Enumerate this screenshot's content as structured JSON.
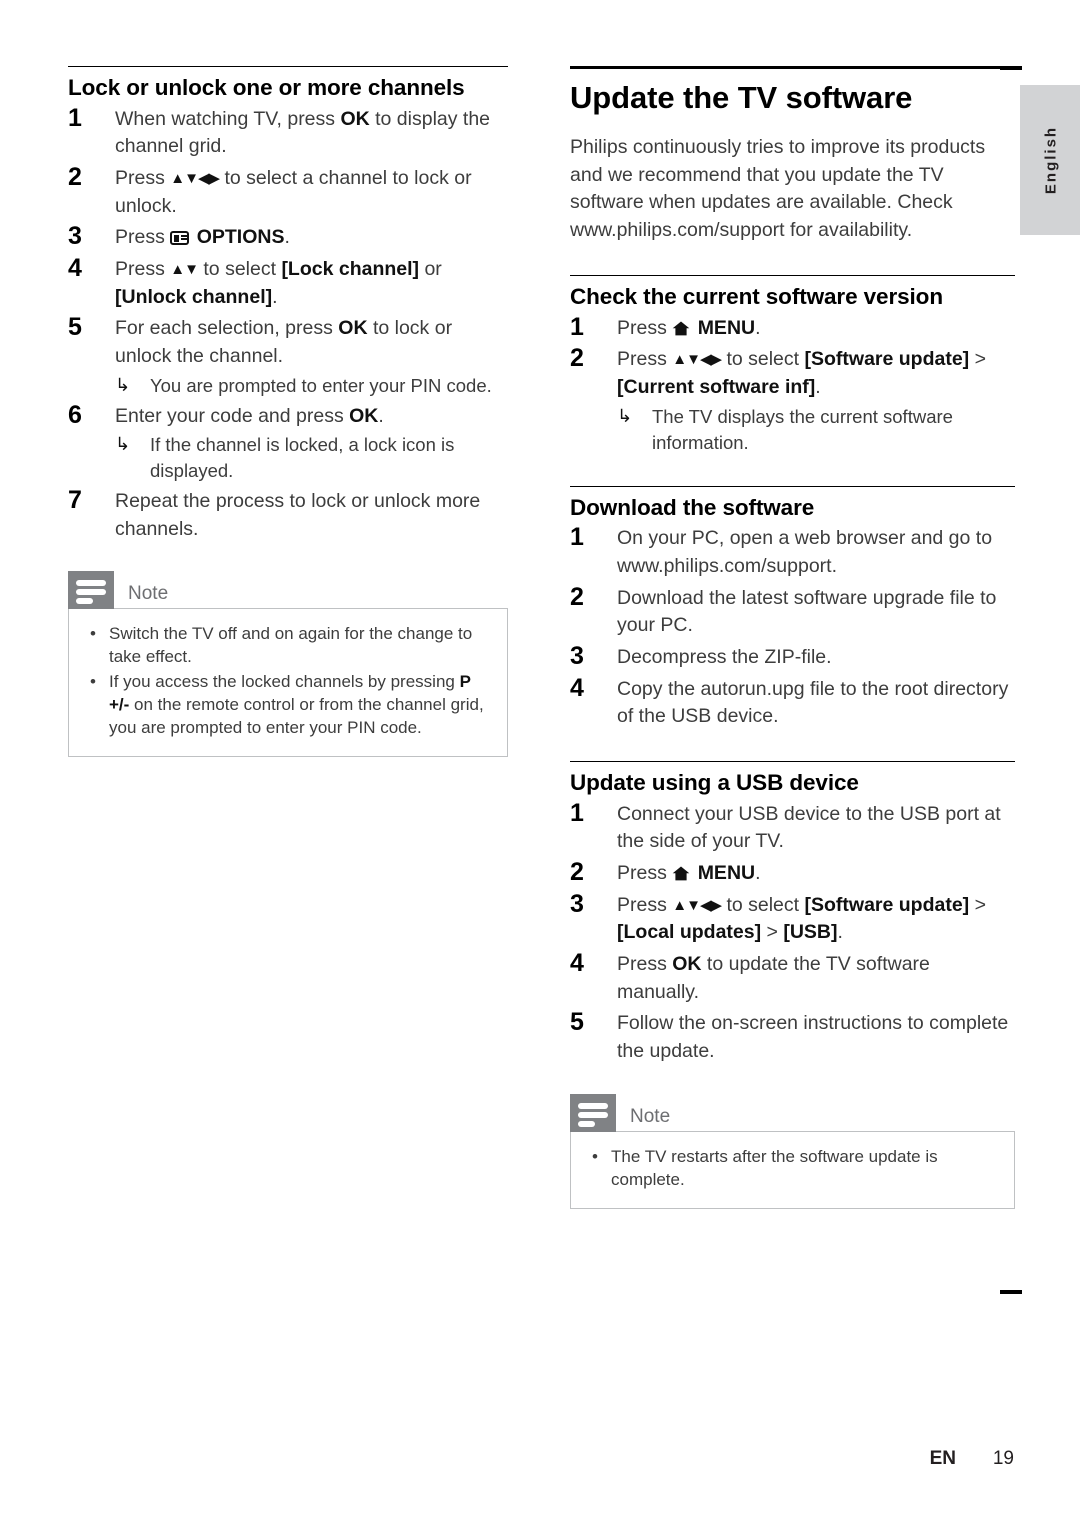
{
  "meta": {
    "language_tab": "English",
    "footer_code": "EN",
    "footer_page": "19"
  },
  "left_column": {
    "heading": "Lock or unlock one or more channels",
    "steps": [
      {
        "num": "1",
        "parts": [
          {
            "t": "When watching TV, press ",
            "b": false
          },
          {
            "t": "OK",
            "b": true
          },
          {
            "t": " to display the channel grid.",
            "b": false
          }
        ]
      },
      {
        "num": "2",
        "parts": [
          {
            "t": "Press ",
            "b": false
          },
          {
            "t": "▲▼◀▶",
            "b": false,
            "keys": true
          },
          {
            "t": " to select a channel to lock or unlock.",
            "b": false
          }
        ]
      },
      {
        "num": "3",
        "icon": "options-icon",
        "parts": [
          {
            "t": "Press ",
            "b": false
          },
          {
            "t": "ICON_OPTIONS",
            "b": false
          },
          {
            "t": "OPTIONS",
            "b": true
          },
          {
            "t": ".",
            "b": false
          }
        ]
      },
      {
        "num": "4",
        "parts": [
          {
            "t": "Press ",
            "b": false
          },
          {
            "t": "▲▼",
            "b": false,
            "keys": true
          },
          {
            "t": " to select ",
            "b": false
          },
          {
            "t": "[Lock channel]",
            "b": true
          },
          {
            "t": " or ",
            "b": false
          },
          {
            "t": "[Unlock channel]",
            "b": true
          },
          {
            "t": ".",
            "b": false
          }
        ]
      },
      {
        "num": "5",
        "parts": [
          {
            "t": "For each selection, press ",
            "b": false
          },
          {
            "t": "OK",
            "b": true
          },
          {
            "t": " to lock or unlock the channel.",
            "b": false
          }
        ],
        "results": [
          "You are prompted to enter your PIN code."
        ]
      },
      {
        "num": "6",
        "parts": [
          {
            "t": "Enter your code and press ",
            "b": false
          },
          {
            "t": "OK",
            "b": true
          },
          {
            "t": ".",
            "b": false
          }
        ],
        "results": [
          "If the channel is locked, a lock icon is displayed."
        ]
      },
      {
        "num": "7",
        "parts": [
          {
            "t": "Repeat the process to lock or unlock more channels.",
            "b": false
          }
        ]
      }
    ],
    "note": {
      "title": "Note",
      "items": [
        [
          {
            "t": "Switch the TV off and on again for the change to take effect.",
            "b": false
          }
        ],
        [
          {
            "t": "If you access the locked channels by pressing ",
            "b": false
          },
          {
            "t": "P +/-",
            "b": true
          },
          {
            "t": " on the remote control or from the channel grid, you are prompted to enter your PIN code.",
            "b": false
          }
        ]
      ]
    }
  },
  "right_column": {
    "chapter_heading": "Update the TV software",
    "intro": "Philips continuously tries to improve its products and we recommend that you update the TV software when updates are available. Check www.philips.com/support for availability.",
    "sections": [
      {
        "heading": "Check the current software version",
        "steps": [
          {
            "num": "1",
            "parts": [
              {
                "t": "Press ",
                "b": false
              },
              {
                "t": "ICON_HOME",
                "b": false
              },
              {
                "t": "MENU",
                "b": true
              },
              {
                "t": ".",
                "b": false
              }
            ]
          },
          {
            "num": "2",
            "parts": [
              {
                "t": "Press ",
                "b": false
              },
              {
                "t": "▲▼◀▶",
                "b": false,
                "keys": true
              },
              {
                "t": " to select ",
                "b": false
              },
              {
                "t": "[Software update]",
                "b": true
              },
              {
                "t": " > ",
                "b": false
              },
              {
                "t": "[Current software inf]",
                "b": true
              },
              {
                "t": ".",
                "b": false
              }
            ],
            "results": [
              "The TV displays the current software information."
            ]
          }
        ]
      },
      {
        "heading": "Download the software",
        "steps": [
          {
            "num": "1",
            "parts": [
              {
                "t": "On your PC, open a web browser and go to www.philips.com/support.",
                "b": false
              }
            ]
          },
          {
            "num": "2",
            "parts": [
              {
                "t": "Download the latest software upgrade file to your PC.",
                "b": false
              }
            ]
          },
          {
            "num": "3",
            "parts": [
              {
                "t": "Decompress the ZIP-file.",
                "b": false
              }
            ]
          },
          {
            "num": "4",
            "parts": [
              {
                "t": "Copy the autorun.upg file to the root directory of the USB device.",
                "b": false
              }
            ]
          }
        ]
      },
      {
        "heading": "Update using a USB device",
        "steps": [
          {
            "num": "1",
            "parts": [
              {
                "t": "Connect your USB device to the USB port at the side of your TV.",
                "b": false
              }
            ]
          },
          {
            "num": "2",
            "parts": [
              {
                "t": "Press ",
                "b": false
              },
              {
                "t": "ICON_HOME",
                "b": false
              },
              {
                "t": "MENU",
                "b": true
              },
              {
                "t": ".",
                "b": false
              }
            ]
          },
          {
            "num": "3",
            "parts": [
              {
                "t": "Press ",
                "b": false
              },
              {
                "t": "▲▼◀▶",
                "b": false,
                "keys": true
              },
              {
                "t": " to select ",
                "b": false
              },
              {
                "t": "[Software update]",
                "b": true
              },
              {
                "t": " > ",
                "b": false
              },
              {
                "t": "[Local updates]",
                "b": true
              },
              {
                "t": " > ",
                "b": false
              },
              {
                "t": "[USB]",
                "b": true
              },
              {
                "t": ".",
                "b": false
              }
            ]
          },
          {
            "num": "4",
            "parts": [
              {
                "t": "Press ",
                "b": false
              },
              {
                "t": "OK",
                "b": true
              },
              {
                "t": " to update the TV software manually.",
                "b": false
              }
            ]
          },
          {
            "num": "5",
            "parts": [
              {
                "t": "Follow the on-screen instructions to complete the update.",
                "b": false
              }
            ]
          }
        ]
      }
    ],
    "note": {
      "title": "Note",
      "items": [
        [
          {
            "t": "The TV restarts after the software update is complete.",
            "b": false
          }
        ]
      ]
    }
  }
}
